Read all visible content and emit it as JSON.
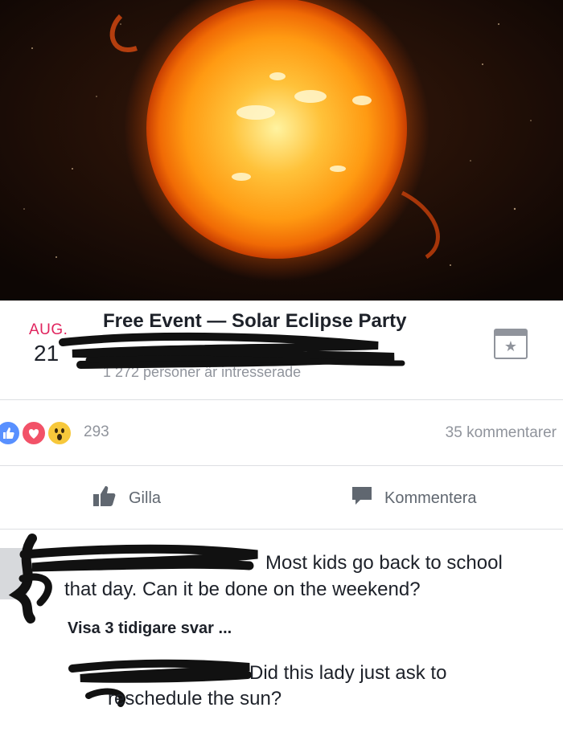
{
  "event": {
    "month": "AUG.",
    "day": "21",
    "title": "Free Event — Solar Eclipse Party",
    "interest": "1 272 personer är intresserade"
  },
  "icons": {
    "hero": "sun-image",
    "save": "star-icon",
    "like": "thumbs-up-icon",
    "comment": "comment-bubble-icon",
    "reactions": [
      "like-reaction-icon",
      "love-reaction-icon",
      "wow-reaction-icon"
    ]
  },
  "stats": {
    "reactions": "293",
    "comments": "35 kommentarer"
  },
  "actions": {
    "like": "Gilla",
    "comment": "Kommentera"
  },
  "comments": [
    {
      "text_line1": "Most kids go back to school",
      "text_line2": "that day. Can it be done on the weekend?"
    }
  ],
  "more_replies": "Visa 3 tidigare svar ...",
  "replies": [
    {
      "text_line1": "Did this lady just ask to",
      "text_line2": "reschedule the sun?"
    }
  ],
  "colors": {
    "month": "#e0245e",
    "secondary_text": "#90949c",
    "like_blue": "#5890ff",
    "love_red": "#f25268",
    "wow_yellow": "#f7c83b"
  }
}
